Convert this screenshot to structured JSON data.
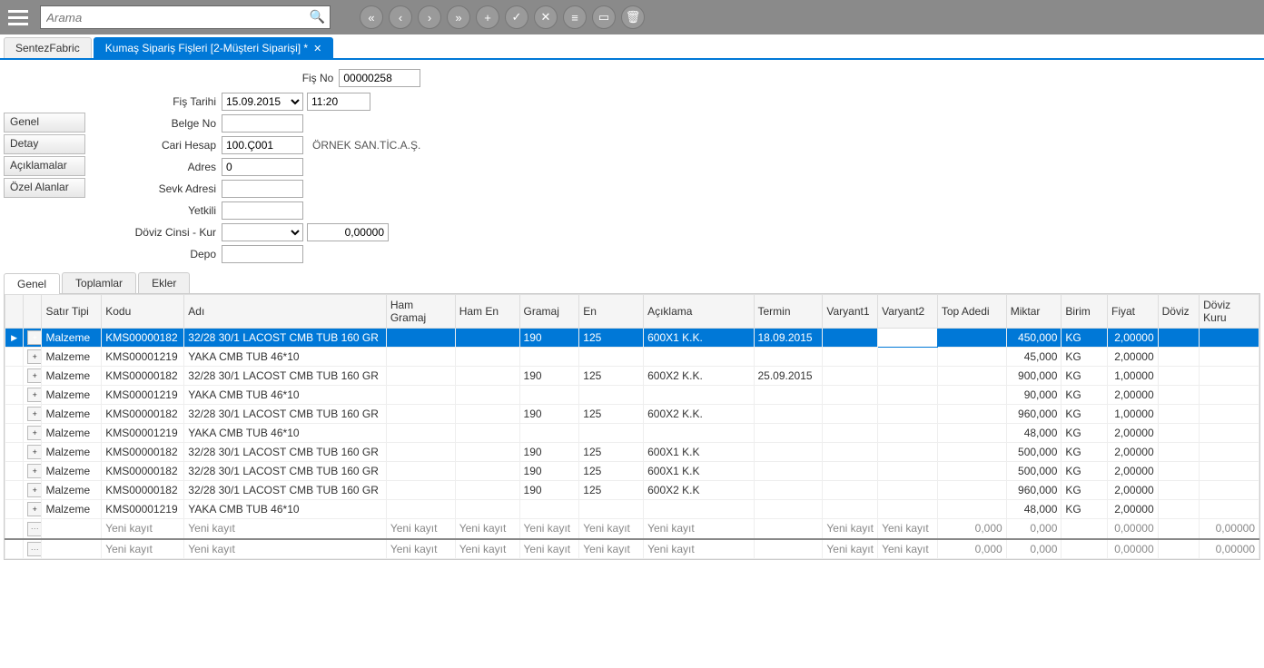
{
  "topbar": {
    "search_placeholder": "Arama",
    "icons": [
      "first",
      "prev",
      "next",
      "last",
      "add",
      "check",
      "cancel",
      "list",
      "card",
      "delete"
    ]
  },
  "tabs": {
    "primary": "SentezFabric",
    "secondary": "Kumaş Sipariş Fişleri  [2-Müşteri Siparişi] *"
  },
  "side": {
    "genel": "Genel",
    "detay": "Detay",
    "aciklamalar": "Açıklamalar",
    "ozel": "Özel Alanlar"
  },
  "form": {
    "fis_no_label": "Fiş No",
    "fis_no": "00000258",
    "fis_tarihi_label": "Fiş Tarihi",
    "fis_tarihi": "15.09.2015",
    "fis_saat": "11:20",
    "belge_no_label": "Belge No",
    "belge_no": "",
    "cari_hesap_label": "Cari Hesap",
    "cari_hesap": "100.Ç001",
    "cari_hesap_adi": "ÖRNEK SAN.TİC.A.Ş.",
    "adres_label": "Adres",
    "adres": "0",
    "sevk_adresi_label": "Sevk Adresi",
    "sevk_adresi": "",
    "yetkili_label": "Yetkili",
    "yetkili": "",
    "doviz_label": "Döviz Cinsi - Kur",
    "doviz_cinsi": "",
    "doviz_kur": "0,00000",
    "depo_label": "Depo",
    "depo": ""
  },
  "gridtabs": {
    "genel": "Genel",
    "toplamlar": "Toplamlar",
    "ekler": "Ekler"
  },
  "grid": {
    "headers": {
      "satir_tipi": "Satır Tipi",
      "kodu": "Kodu",
      "adi": "Adı",
      "ham_gramaj": "Ham Gramaj",
      "ham_en": "Ham En",
      "gramaj": "Gramaj",
      "en": "En",
      "aciklama": "Açıklama",
      "termin": "Termin",
      "varyant1": "Varyant1",
      "varyant2": "Varyant2",
      "top_adedi": "Top Adedi",
      "miktar": "Miktar",
      "birim": "Birim",
      "fiyat": "Fiyat",
      "doviz": "Döviz",
      "doviz_kuru": "Döviz Kuru"
    },
    "rows": [
      {
        "tip": "Malzeme",
        "kod": "KMS00000182",
        "adi": "32/28 30/1 LACOST CMB TUB 160 GR",
        "hg": "",
        "he": "",
        "gr": "190",
        "en": "125",
        "ac": "600X1 K.K.",
        "ter": "18.09.2015",
        "v1": "",
        "v2": "",
        "top": "",
        "mik": "450,000",
        "bir": "KG",
        "fiy": "2,00000",
        "dov": "",
        "dk": ""
      },
      {
        "tip": "Malzeme",
        "kod": "KMS00001219",
        "adi": "YAKA CMB TUB 46*10",
        "hg": "",
        "he": "",
        "gr": "",
        "en": "",
        "ac": "",
        "ter": "",
        "v1": "",
        "v2": "",
        "top": "",
        "mik": "45,000",
        "bir": "KG",
        "fiy": "2,00000",
        "dov": "",
        "dk": ""
      },
      {
        "tip": "Malzeme",
        "kod": "KMS00000182",
        "adi": "32/28 30/1 LACOST CMB TUB 160 GR",
        "hg": "",
        "he": "",
        "gr": "190",
        "en": "125",
        "ac": "600X2 K.K.",
        "ter": "25.09.2015",
        "v1": "",
        "v2": "",
        "top": "",
        "mik": "900,000",
        "bir": "KG",
        "fiy": "1,00000",
        "dov": "",
        "dk": ""
      },
      {
        "tip": "Malzeme",
        "kod": "KMS00001219",
        "adi": "YAKA CMB TUB 46*10",
        "hg": "",
        "he": "",
        "gr": "",
        "en": "",
        "ac": "",
        "ter": "",
        "v1": "",
        "v2": "",
        "top": "",
        "mik": "90,000",
        "bir": "KG",
        "fiy": "2,00000",
        "dov": "",
        "dk": ""
      },
      {
        "tip": "Malzeme",
        "kod": "KMS00000182",
        "adi": "32/28 30/1 LACOST CMB TUB 160 GR",
        "hg": "",
        "he": "",
        "gr": "190",
        "en": "125",
        "ac": "600X2 K.K.",
        "ter": "",
        "v1": "",
        "v2": "",
        "top": "",
        "mik": "960,000",
        "bir": "KG",
        "fiy": "1,00000",
        "dov": "",
        "dk": ""
      },
      {
        "tip": "Malzeme",
        "kod": "KMS00001219",
        "adi": "YAKA CMB TUB 46*10",
        "hg": "",
        "he": "",
        "gr": "",
        "en": "",
        "ac": "",
        "ter": "",
        "v1": "",
        "v2": "",
        "top": "",
        "mik": "48,000",
        "bir": "KG",
        "fiy": "2,00000",
        "dov": "",
        "dk": ""
      },
      {
        "tip": "Malzeme",
        "kod": "KMS00000182",
        "adi": "32/28 30/1 LACOST CMB TUB 160 GR",
        "hg": "",
        "he": "",
        "gr": "190",
        "en": "125",
        "ac": "600X1 K.K",
        "ter": "",
        "v1": "",
        "v2": "",
        "top": "",
        "mik": "500,000",
        "bir": "KG",
        "fiy": "2,00000",
        "dov": "",
        "dk": ""
      },
      {
        "tip": "Malzeme",
        "kod": "KMS00000182",
        "adi": "32/28 30/1 LACOST CMB TUB 160 GR",
        "hg": "",
        "he": "",
        "gr": "190",
        "en": "125",
        "ac": "600X1 K.K",
        "ter": "",
        "v1": "",
        "v2": "",
        "top": "",
        "mik": "500,000",
        "bir": "KG",
        "fiy": "2,00000",
        "dov": "",
        "dk": ""
      },
      {
        "tip": "Malzeme",
        "kod": "KMS00000182",
        "adi": "32/28 30/1 LACOST CMB TUB 160 GR",
        "hg": "",
        "he": "",
        "gr": "190",
        "en": "125",
        "ac": "600X2 K.K",
        "ter": "",
        "v1": "",
        "v2": "",
        "top": "",
        "mik": "960,000",
        "bir": "KG",
        "fiy": "2,00000",
        "dov": "",
        "dk": ""
      },
      {
        "tip": "Malzeme",
        "kod": "KMS00001219",
        "adi": "YAKA CMB TUB 46*10",
        "hg": "",
        "he": "",
        "gr": "",
        "en": "",
        "ac": "",
        "ter": "",
        "v1": "",
        "v2": "",
        "top": "",
        "mik": "48,000",
        "bir": "KG",
        "fiy": "2,00000",
        "dov": "",
        "dk": ""
      }
    ],
    "new_row": {
      "tip": "",
      "kod": "Yeni kayıt",
      "adi": "Yeni kayıt",
      "hg": "Yeni kayıt",
      "he": "Yeni kayıt",
      "gr": "Yeni kayıt",
      "en": "Yeni kayıt",
      "ac": "Yeni kayıt",
      "ter": "",
      "v1": "Yeni kayıt",
      "v2": "Yeni kayıt",
      "top": "0,000",
      "mik": "0,000",
      "bir": "",
      "fiy": "0,00000",
      "dov": "",
      "dk": "0,00000"
    }
  }
}
